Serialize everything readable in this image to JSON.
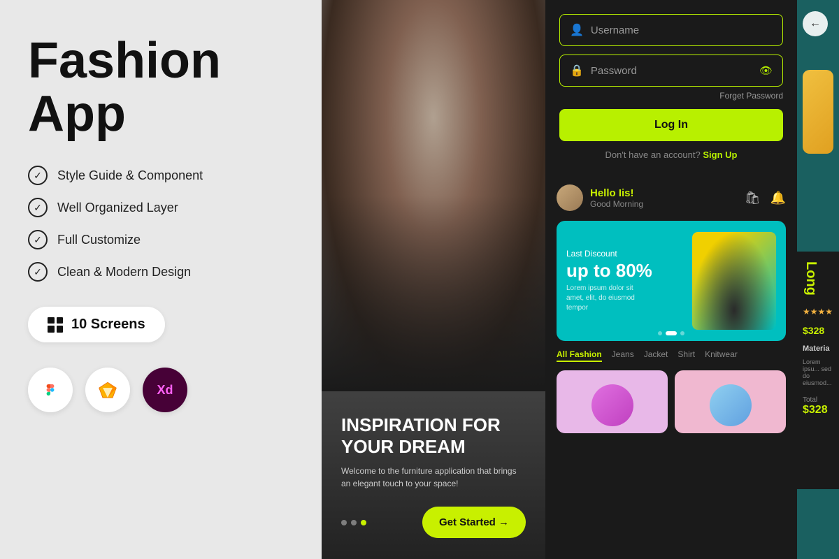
{
  "left": {
    "title_line1": "Fashion",
    "title_line2": "App",
    "features": [
      "Style Guide & Component",
      "Well Organized Layer",
      "Full Customize",
      "Clean & Modern Design"
    ],
    "screens_badge": "10 Screens",
    "tools": [
      "Figma",
      "Sketch",
      "XD"
    ]
  },
  "phone_main": {
    "headline_line1": "INSPIRATION FOR",
    "headline_line2": "YOUR DREAM",
    "subtext": "Welcome to the furniture application that brings an elegant touch to your space!",
    "cta_button": "Get Started →",
    "dots": [
      false,
      false,
      true
    ]
  },
  "login": {
    "username_placeholder": "Username",
    "password_placeholder": "Password",
    "forget_pw": "Forget Password",
    "login_btn": "Log In",
    "signup_text": "Don't have an account?",
    "signup_link": "Sign Up"
  },
  "home": {
    "greeting": "Hello Iis!",
    "subgreeting": "Good Morning",
    "banner": {
      "label": "Last Discount",
      "discount": "up to 80%",
      "desc": "Lorem ipsum dolor sit amet, elit, do eiusmod tempor"
    },
    "categories": [
      "All Fashion",
      "Jeans",
      "Jacket",
      "Shirt",
      "Knitwear"
    ]
  },
  "product": {
    "name": "Long",
    "price": "$328",
    "price_total_label": "Total",
    "price_total": "$328",
    "material_label": "Materia",
    "material_desc": "Lorem ipsu... sed do eiusmod..."
  },
  "accent_color": "#c8f000",
  "login_border_color": "#b8f000"
}
